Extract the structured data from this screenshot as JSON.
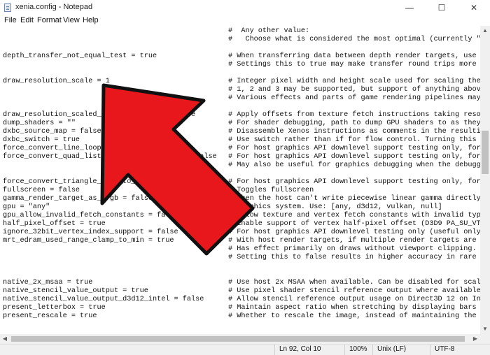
{
  "window": {
    "title": "xenia.config - Notepad",
    "minimize_glyph": "—",
    "maximize_glyph": "☐",
    "close_glyph": "✕"
  },
  "menu": [
    "File",
    "Edit",
    "Format",
    "View",
    "Help"
  ],
  "lines": [
    {
      "left": "",
      "right": "#  Any other value:"
    },
    {
      "left": "",
      "right": "#   Choose what is considered the most optimal (currently \"on_c"
    },
    {
      "left": "",
      "right": ""
    },
    {
      "left": "depth_transfer_not_equal_test = true",
      "right": "# When transferring data between depth render targets, use the"
    },
    {
      "left": "",
      "right": "# Settings this to true may make transfer round trips more frie"
    },
    {
      "left": "",
      "right": ""
    },
    {
      "left": "draw_resolution_scale = 1",
      "right": "# Integer pixel width and height scale used for scaling the ren"
    },
    {
      "left": "",
      "right": "# 1, 2 and 3 may be supported, but support of anything above 1"
    },
    {
      "left": "",
      "right": "# Various effects and parts of game rendering pipelines may wor"
    },
    {
      "left": "",
      "right": ""
    },
    {
      "left": "draw_resolution_scaled_texture_offsets = true",
      "right": "# Apply offsets from texture fetch instructions taking resoluti"
    },
    {
      "left": "dump_shaders = \"\"",
      "right": "# For shader debugging, path to dump GPU shaders to as they are"
    },
    {
      "left": "dxbc_source_map = false",
      "right": "# Disassemble Xenos instructions as comments in the resulting D"
    },
    {
      "left": "dxbc_switch = true",
      "right": "# Use switch rather than if for flow control. Turning this off"
    },
    {
      "left": "force_convert_line_loops_to_strips = false",
      "right": "# For host graphics API downlevel support testing only, force C"
    },
    {
      "left": "force_convert_quad_lists_to_triangle_lists = false",
      "right": "# For host graphics API downlevel support testing only, force C"
    },
    {
      "left": "",
      "right": "# May also be useful for graphics debugging when the debugger d"
    },
    {
      "left": "",
      "right": ""
    },
    {
      "left": "force_convert_triangle_fans_to_lists = false",
      "right": "# For host graphics API downlevel support testing only, force C"
    },
    {
      "left": "fullscreen = false",
      "right": "# Toggles fullscreen"
    },
    {
      "left": "gamma_render_target_as_srgb = false",
      "right": "# When the host can't write piecewise linear gamma directly wit"
    },
    {
      "left": "gpu = \"any\"",
      "right": "# Graphics system. Use: [any, d3d12, vulkan, null]"
    },
    {
      "left": "gpu_allow_invalid_fetch_constants = false",
      "right": "# Allow texture and vertex fetch constants with invalid type -"
    },
    {
      "left": "half_pixel_offset = true",
      "right": "# Enable support of vertex half-pixel offset (D3D9 PA_SU_VTX_CN"
    },
    {
      "left": "ignore_32bit_vertex_index_support = false",
      "right": "# For host graphics API downlevel testing only (useful only for"
    },
    {
      "left": "mrt_edram_used_range_clamp_to_min = true",
      "right": "# With host render targets, if multiple render targets are boun"
    },
    {
      "left": "",
      "right": "# Has effect primarily on draws without viewport clipping."
    },
    {
      "left": "",
      "right": "# Setting this to false results in higher accuracy in rare case"
    },
    {
      "left": "",
      "right": ""
    },
    {
      "left": "",
      "right": ""
    },
    {
      "left": "native_2x_msaa = true",
      "right": "# Use host 2x MSAA when available. Can be disabled for scalabil"
    },
    {
      "left": "native_stencil_value_output = true",
      "right": "# Use pixel shader stencil reference output where available for"
    },
    {
      "left": "native_stencil_value_output_d3d12_intel = false",
      "right": "# Allow stencil reference output usage on Direct3D 12 on Intel"
    },
    {
      "left": "present_letterbox = true",
      "right": "# Maintain aspect ratio when stretching by displaying bars arou"
    },
    {
      "left": "present_rescale = true",
      "right": "# Whether to rescale the image, instead of maintaining the orig"
    }
  ],
  "status": {
    "position": "Ln 92, Col 10",
    "zoom": "100%",
    "line_ending": "Unix (LF)",
    "encoding": "UTF-8"
  },
  "overlay": {
    "color": "#e8171b",
    "icon": "big-red-arrow-icon"
  }
}
